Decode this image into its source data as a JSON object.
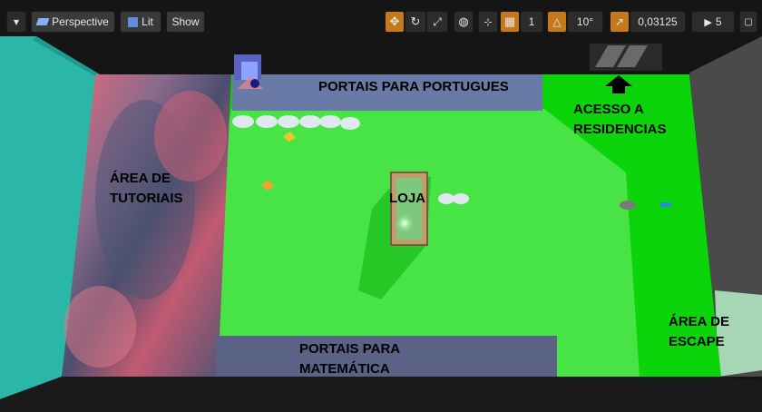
{
  "toolbar": {
    "viewport_menu": "▾",
    "perspective_label": "Perspective",
    "lit_label": "Lit",
    "show_label": "Show",
    "grid_size": "1",
    "rotation_snap": "10°",
    "scale_snap": "0,03125",
    "camera_speed": "5"
  },
  "labels": {
    "portais_portugues": "PORTAIS PARA PORTUGUES",
    "acesso_residencias": "ACESSO A\nRESIDENCIAS",
    "area_tutoriais": "ÁREA DE\nTUTORIAIS",
    "loja": "LOJA",
    "area_escape": "ÁREA DE\nESCAPE",
    "portais_matematica": "PORTAIS PARA\nMATEMÁTICA"
  },
  "colors": {
    "floor_green": "#0bd40b",
    "light_green": "#66ee55",
    "wall_teal": "#2ab7a8",
    "accent_orange": "#c47a1c"
  }
}
